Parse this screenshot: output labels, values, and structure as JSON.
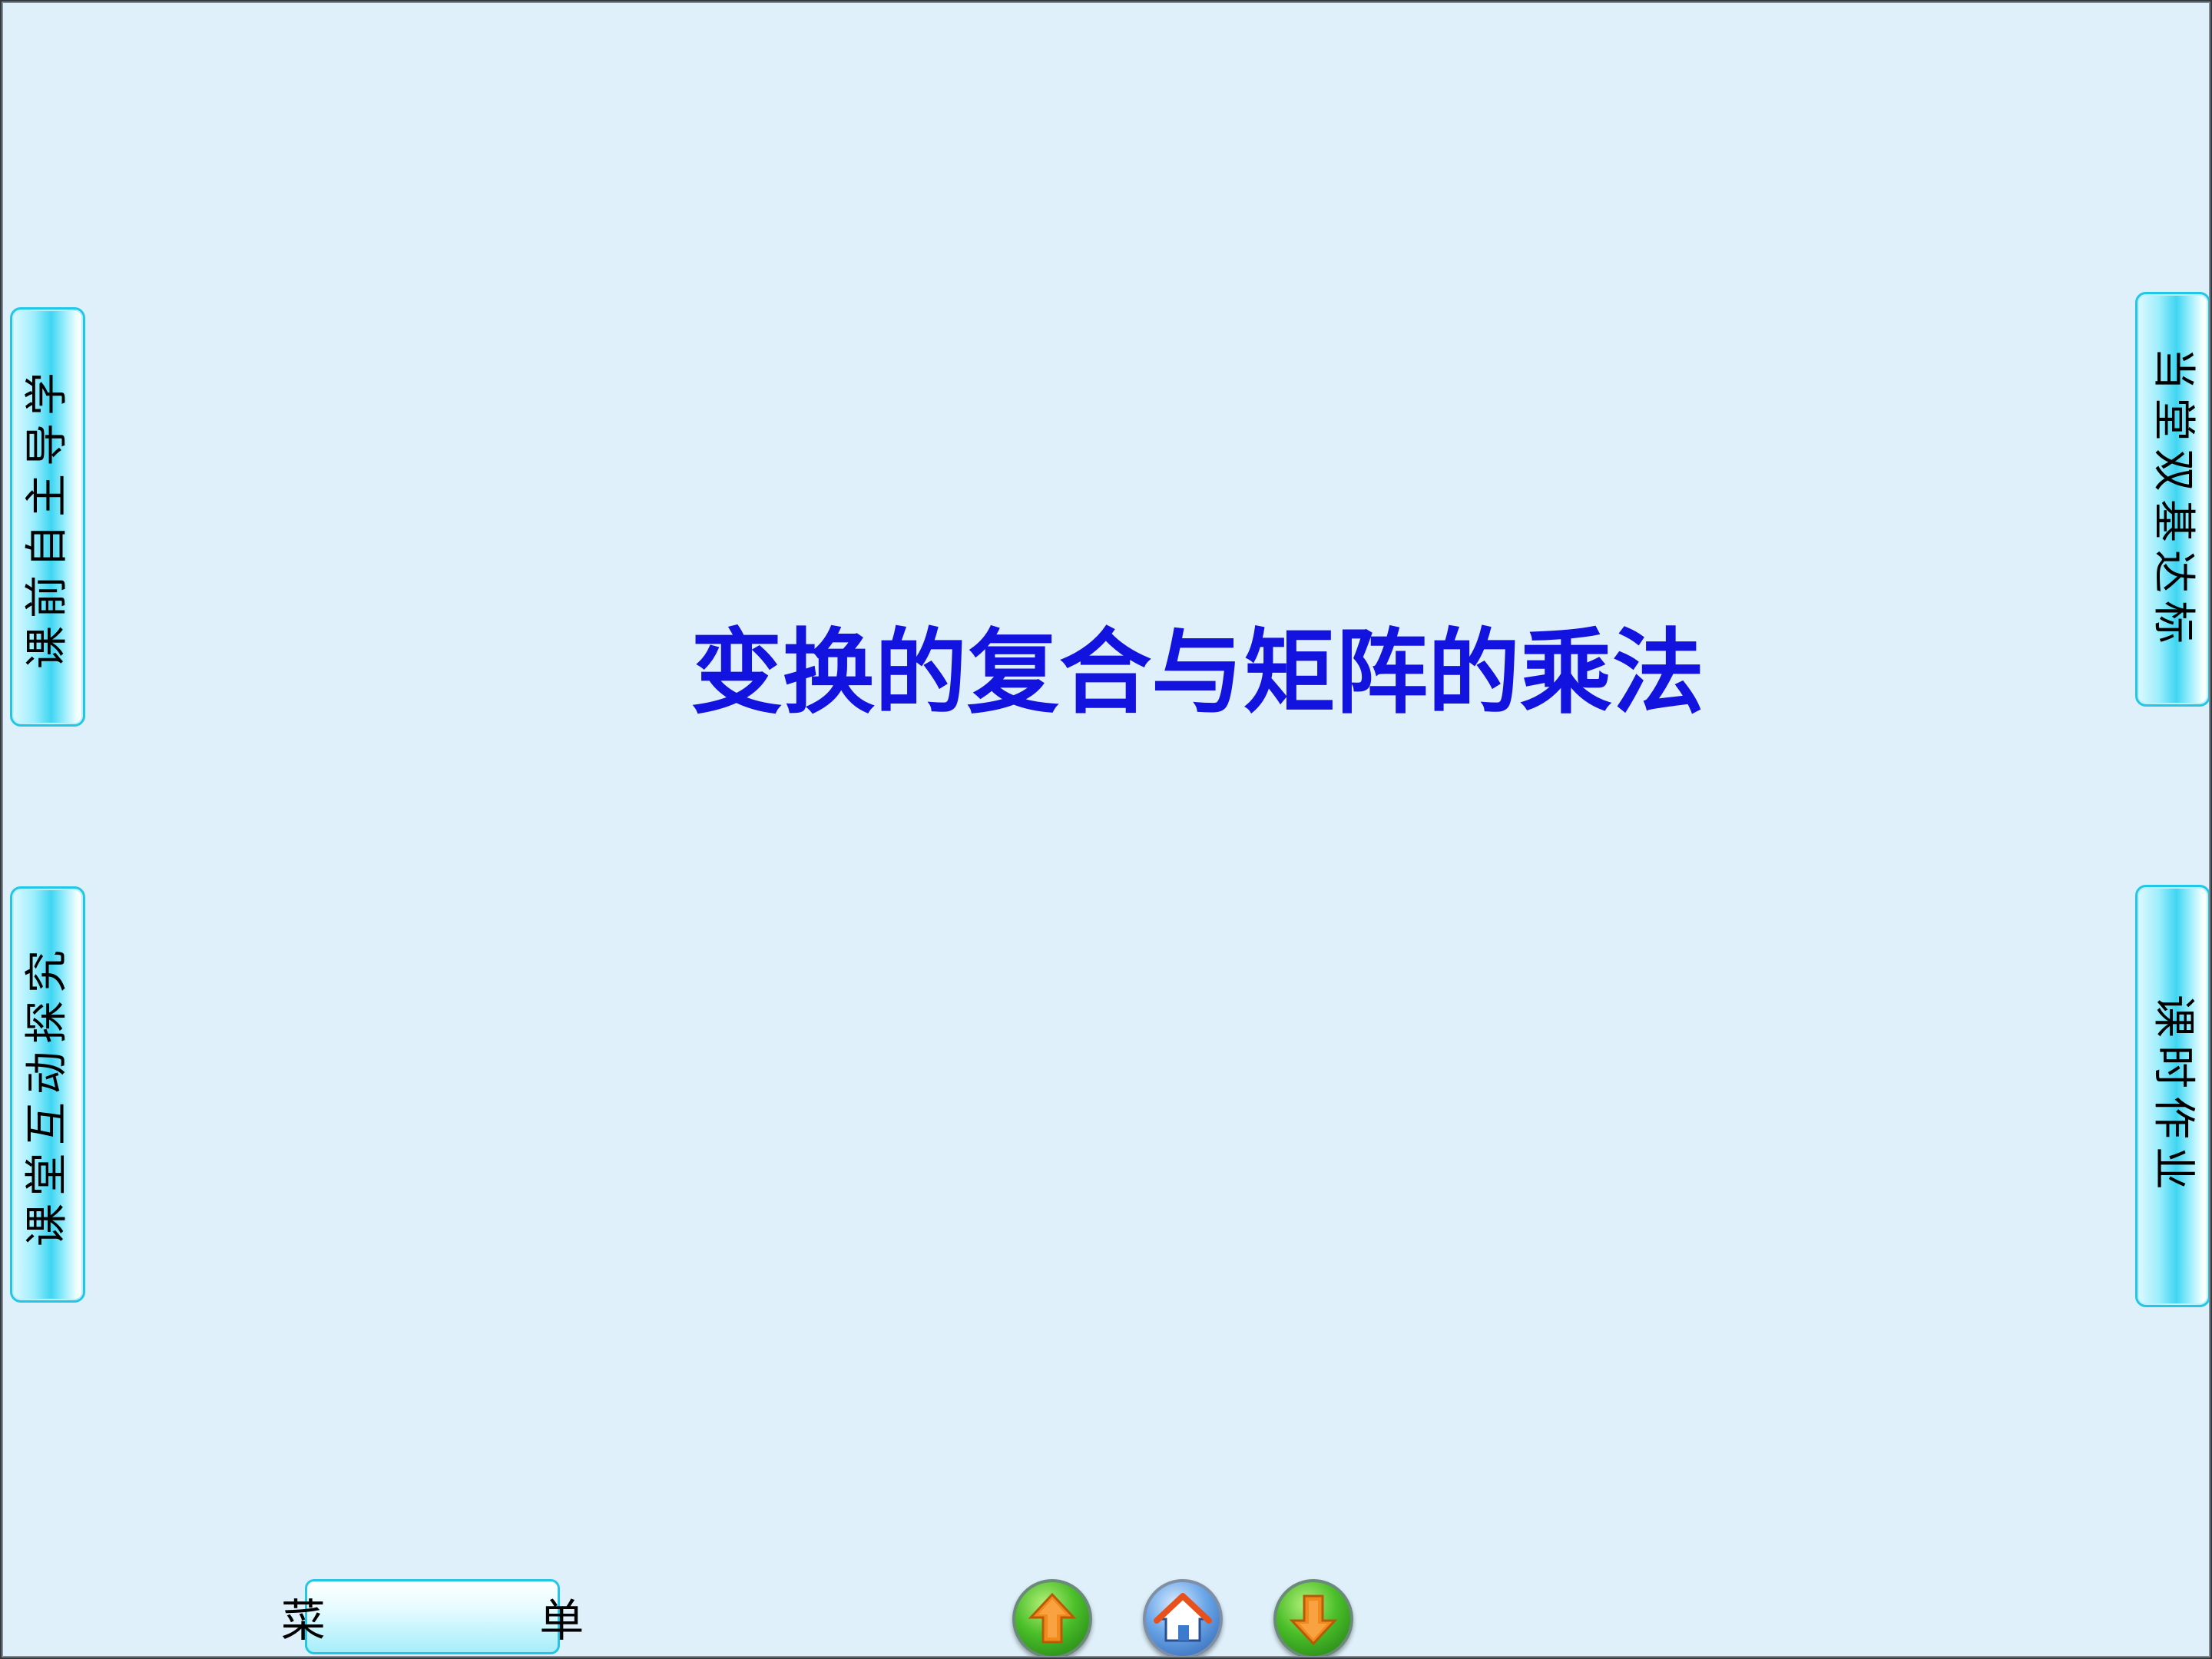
{
  "slide": {
    "title": "变换的复合与矩阵的乘法"
  },
  "side_tabs": {
    "left_top": "课前自主导学",
    "left_bottom": "课堂互动探究",
    "right_top": "当堂双基达标",
    "right_bottom": "课时作业"
  },
  "menu": {
    "label": "菜 单"
  },
  "nav": {
    "prev_icon": "up-arrow-icon",
    "home_icon": "home-icon",
    "next_icon": "down-arrow-icon"
  },
  "colors": {
    "background": "#dff0fa",
    "title": "#1313e0",
    "tab_border": "#22c6e6",
    "tab_fill": "#3fd6f2"
  }
}
